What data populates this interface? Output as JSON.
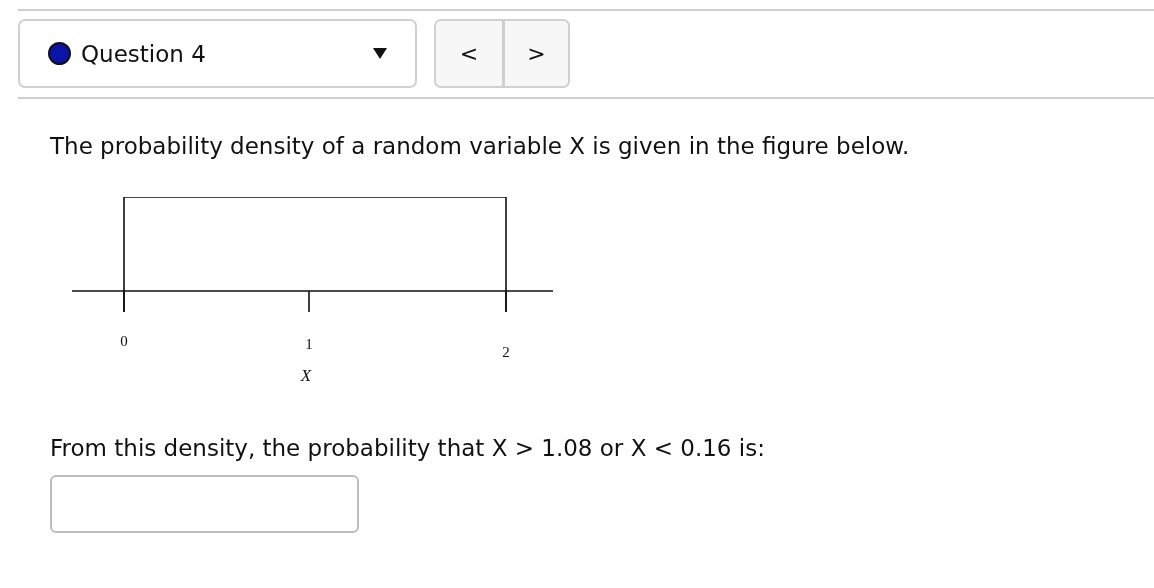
{
  "question_selector": {
    "label": "Question 4"
  },
  "navigation": {
    "previous": "<",
    "next": ">"
  },
  "question": {
    "prompt": "The probability density of a random variable X is given in the figure below.",
    "figure": {
      "tick_labels": [
        "0",
        "1",
        "2"
      ],
      "axis_label": "X"
    },
    "ask": "From this density, the probability that X > 1.08 or X < 0.16 is:"
  }
}
